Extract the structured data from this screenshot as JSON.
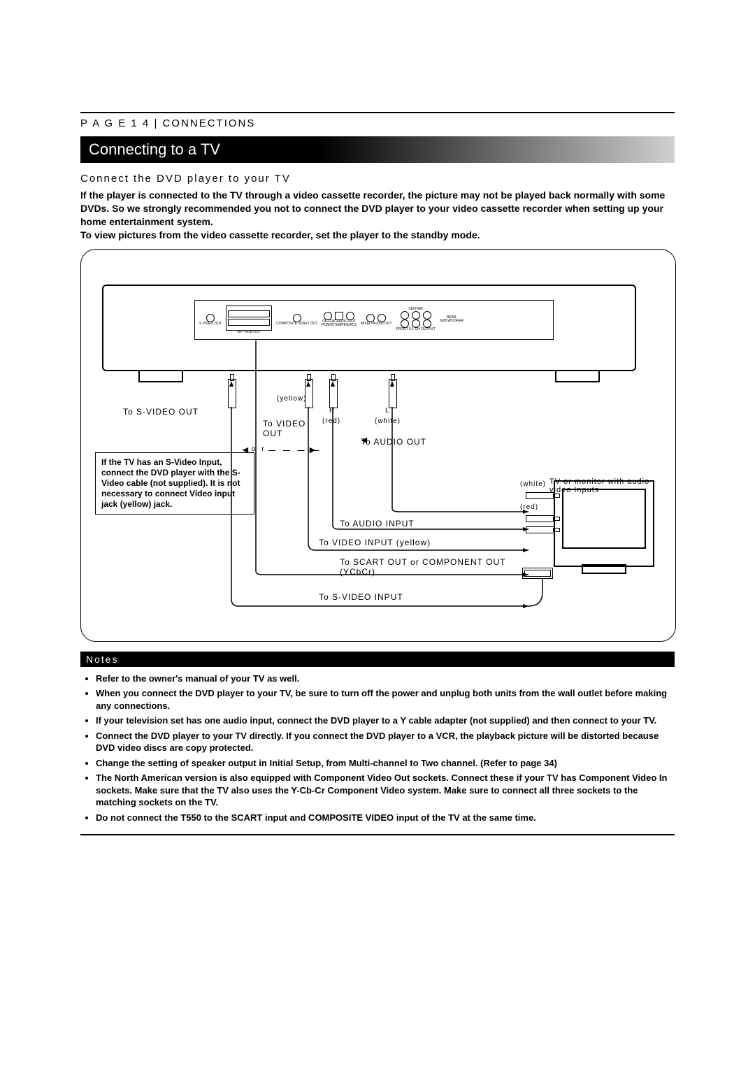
{
  "header": {
    "page_label": "P A G E 1 4",
    "divider": "|",
    "section": "CONNECTIONS"
  },
  "title": "Connecting to a TV",
  "subheading": "Connect the DVD player to your TV",
  "intro": "If the player is connected to the TV through a video cassette recorder, the picture may not be played back normally with some DVDs. So we strongly recommended you not to connect the DVD player to your video cassette recorder when setting up your home entertainment system.\nTo view pictures from the video cassette recorder, set the player to the standby mode.",
  "diagram": {
    "back_panel": {
      "svideo_out": "S VIDEO OUT",
      "av_rgb_out": "AV / RGB OUT",
      "composite_video_out": "COMPOSITE VIDEO OUT",
      "digital_audio_out": "DIGITAL AUDIO OUT",
      "pcm_dts_mpeg_ac3": "PCM/DTS/MPEG/AC3",
      "center": "CENTER",
      "mixed_audio_out": "MIXED AUDIO OUT",
      "front_51ch": "FRONT 5.1 CH OUTPUT",
      "rear": "REAR",
      "sub_woofer": "SUB WOOFER"
    },
    "yellow": "(yellow)",
    "to_svideo_out": "To S-VIDEO OUT",
    "r": "R",
    "l": "L",
    "red": "(red)",
    "white": "(white)",
    "to_video_out": "To VIDEO OUT",
    "to_audio_out": "To AUDIO OUT",
    "or": "o r",
    "svideo_tip": "If the TV has an S-Video Input, connect the DVD player with the S-Video cable (not supplied). It is not necessary to connect Video input jack (yellow) jack.",
    "white2": "(white)",
    "red2": "(red)",
    "tv_label": "TV or monitor with audio video Inputs",
    "to_audio_input": "To AUDIO INPUT",
    "to_video_input": "To VIDEO INPUT (yellow)",
    "to_scart_component": "To SCART OUT or COMPONENT OUT (YCbCr)",
    "to_svideo_input": "To S-VIDEO INPUT"
  },
  "notes_label": "Notes",
  "notes": [
    "Refer to the owner's manual of your TV as well.",
    "When you connect the DVD player to your TV, be sure to turn off the power and unplug both units from the wall outlet before making any connections.",
    "If your television set has one audio input, connect the DVD player to a Y cable adapter (not supplied) and then connect to your TV.",
    "Connect the DVD player to your TV directly. If you connect the DVD player to a VCR, the playback picture will be distorted because DVD video discs are copy protected.",
    "Change the setting of speaker output in Initial Setup, from Multi-channel to Two channel. (Refer to page 34)",
    "The North American version is also equipped with Component Video Out sockets. Connect these if your TV has Component Video In sockets. Make sure that the TV also uses the Y-Cb-Cr Component Video system. Make sure to connect all three sockets to the matching sockets on the TV.",
    "Do not connect the T550 to the SCART input and COMPOSITE VIDEO input of the TV at the same time."
  ]
}
